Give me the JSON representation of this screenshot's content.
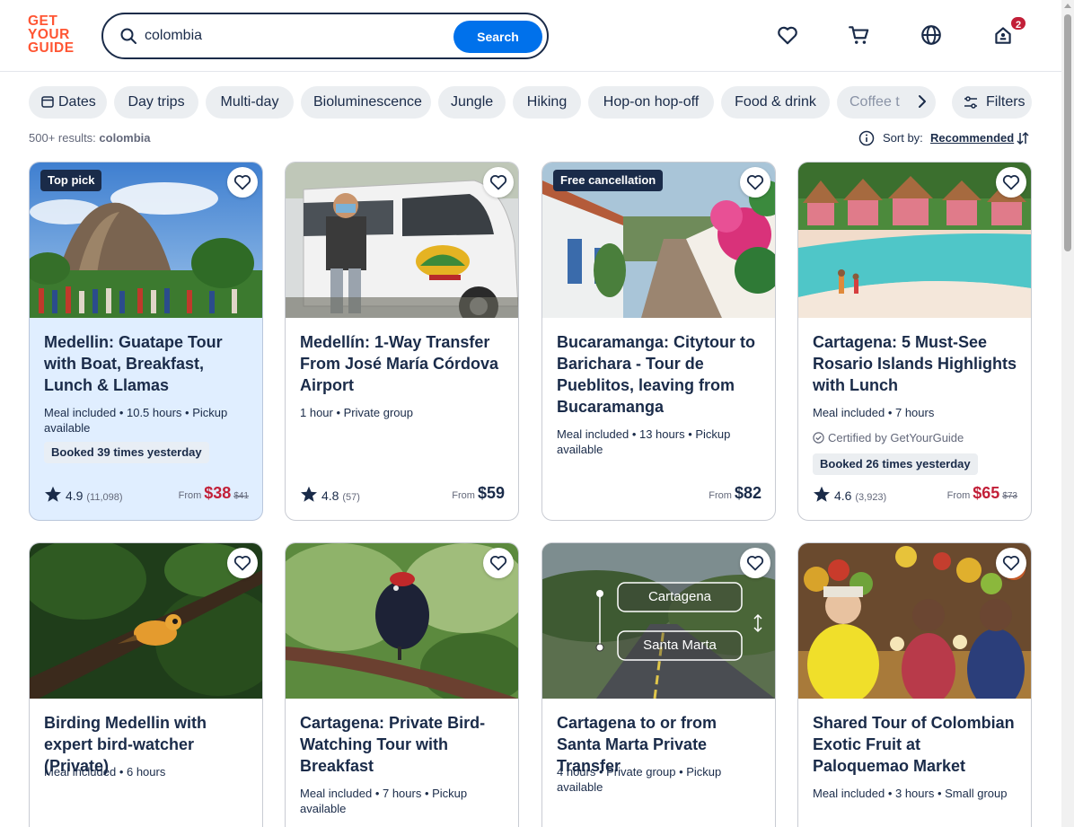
{
  "header": {
    "logo_lines": [
      "GET",
      "YOUR",
      "GUIDE"
    ],
    "search_value": "colombia",
    "search_button": "Search",
    "cart_badge": "2"
  },
  "chips": [
    "Dates",
    "Day trips",
    "Multi-day",
    "Bioluminescence",
    "Jungle",
    "Hiking",
    "Hop-on hop-off",
    "Food & drink",
    "Coffee t"
  ],
  "filters_label": "Filters",
  "results": {
    "count": "500+ results:",
    "query": "colombia"
  },
  "sort": {
    "label": "Sort by:",
    "value": "Recommended"
  },
  "cards": [
    {
      "tag": "Top pick",
      "title": "Medellin: Guatape Tour with Boat, Breakfast, Lunch & Llamas",
      "meta": "Meal included • 10.5 hours • Pickup available",
      "booked": "Booked 39 times yesterday",
      "rating": "4.9",
      "reviews": "(11,098)",
      "from": "From",
      "price": "$38",
      "old_price": "$41"
    },
    {
      "title": "Medellín: 1-Way Transfer From José María Córdova Airport",
      "meta": "1 hour • Private group",
      "rating": "4.8",
      "reviews": "(57)",
      "from": "From",
      "price": "$59"
    },
    {
      "tag": "Free cancellation",
      "title": "Bucaramanga: Citytour to Barichara - Tour de Pueblitos, leaving from Bucaramanga",
      "meta": "Meal included • 13 hours • Pickup available",
      "from": "From",
      "price": "$82"
    },
    {
      "title": "Cartagena: 5 Must-See Rosario Islands Highlights with Lunch",
      "meta": "Meal included • 7 hours",
      "certified": "Certified by GetYourGuide",
      "booked": "Booked 26 times yesterday",
      "rating": "4.6",
      "reviews": "(3,923)",
      "from": "From",
      "price": "$65",
      "old_price": "$73"
    },
    {
      "title": "Birding Medellin with expert bird-watcher (Private)",
      "meta": "Meal included • 6 hours"
    },
    {
      "title": "Cartagena: Private Bird-Watching Tour with Breakfast",
      "meta": "Meal included • 7 hours • Pickup available"
    },
    {
      "title": "Cartagena to or from Santa Marta Private Transfer",
      "meta": "4 hours • Private group • Pickup available",
      "image_labels": [
        "Cartagena",
        "Santa Marta"
      ]
    },
    {
      "title": "Shared Tour of Colombian Exotic Fruit at Paloquemao Market",
      "meta": "Meal included • 3 hours • Small group"
    }
  ],
  "colors": {
    "brand": "#ff5533",
    "accent": "#0071eb",
    "sale": "#c21f38",
    "ink": "#1a2b49",
    "highlight": "#e0eeff"
  }
}
